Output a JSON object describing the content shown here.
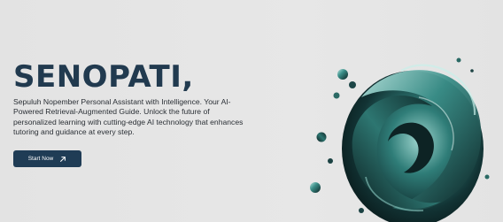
{
  "hero": {
    "title": "SENOPATI,",
    "description": "Sepuluh Nopember Personal Assistant with Intelligence. Your AI-Powered Retrieval-Augmented Guide. Unlock the future of personalized learning with cutting-edge AI technology that enhances tutoring and guidance at every step.",
    "cta_label": "Start Now",
    "cta_icon": "arrow-up-right-icon"
  },
  "colors": {
    "background": "#e6e6e6",
    "title": "#213a4f",
    "button": "#1f3c55",
    "art_teal": "#2f7d78",
    "art_dark": "#0f2a2b"
  },
  "art": {
    "icon": "abstract-3d-swirl-art"
  }
}
